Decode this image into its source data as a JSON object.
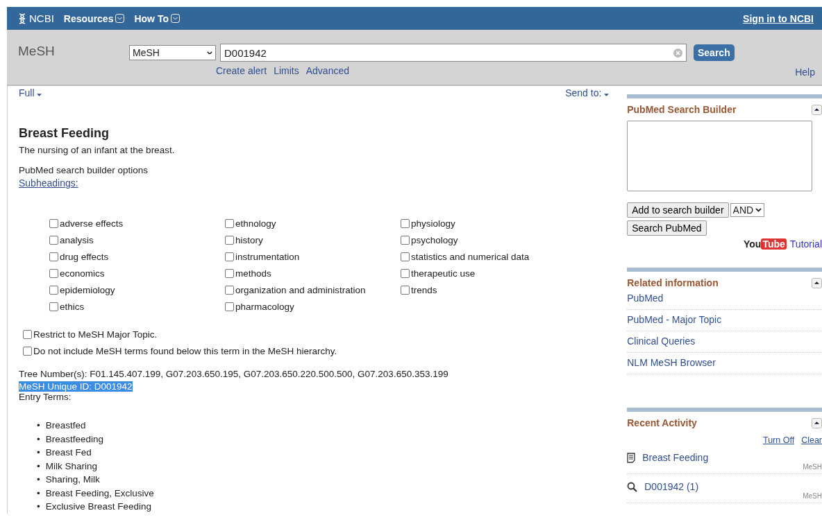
{
  "topbar": {
    "logo": "NCBI",
    "menus": [
      {
        "label": "Resources"
      },
      {
        "label": "How To"
      }
    ],
    "sign_in": "Sign in to NCBI"
  },
  "search": {
    "database_label": "MeSH",
    "database": "MeSH",
    "value": "D001942",
    "button": "Search",
    "links": [
      "Create alert",
      "Limits",
      "Advanced"
    ],
    "help": "Help"
  },
  "content": {
    "display": "Full",
    "send_to": "Send to:",
    "title": "Breast Feeding",
    "definition": "The nursing of an infant at the breast.",
    "builder_options": "PubMed search builder options",
    "subheadings_link": "Subheadings:",
    "subheadings": [
      [
        {
          "label": "adverse effects",
          "checked": false
        },
        {
          "label": "analysis",
          "checked": false
        },
        {
          "label": "drug effects",
          "checked": false
        },
        {
          "label": "economics",
          "checked": false
        },
        {
          "label": "epidemiology",
          "checked": false
        },
        {
          "label": "ethics",
          "checked": false
        }
      ],
      [
        {
          "label": "ethnology",
          "checked": false
        },
        {
          "label": "history",
          "checked": false
        },
        {
          "label": "instrumentation",
          "checked": false
        },
        {
          "label": "methods",
          "checked": false
        },
        {
          "label": "organization and administration",
          "checked": false
        },
        {
          "label": "pharmacology",
          "checked": false
        }
      ],
      [
        {
          "label": "physiology",
          "checked": false
        },
        {
          "label": "psychology",
          "checked": false
        },
        {
          "label": "statistics and numerical data",
          "checked": false
        },
        {
          "label": "therapeutic use",
          "checked": false
        },
        {
          "label": "trends",
          "checked": false
        }
      ]
    ],
    "options": [
      {
        "label": "Restrict to MeSH Major Topic.",
        "checked": false
      },
      {
        "label": "Do not include MeSH terms found below this term in the MeSH hierarchy.",
        "checked": false
      }
    ],
    "tree_numbers": "Tree Number(s): F01.145.407.199, G07.203.650.195, G07.203.650.220.500.500, G07.203.650.353.199",
    "unique_id": {
      "text": "MeSH Unique ID: D001942",
      "highlighted": true
    },
    "entry_terms_label": "Entry Terms:",
    "entry_marker": "•",
    "entry_terms": [
      "Breastfed",
      "Breastfeeding",
      "Breast Fed",
      "Milk Sharing",
      "Sharing, Milk",
      "Breast Feeding, Exclusive",
      "Exclusive Breast Feeding"
    ]
  },
  "sidebar": {
    "builder": {
      "title": "PubMed Search Builder",
      "add_button": "Add to search builder",
      "operator": "AND",
      "search_button": "Search PubMed",
      "youtube": [
        "You",
        "Tube"
      ],
      "tutorial": "Tutorial"
    },
    "related": {
      "title": "Related information",
      "links": [
        "PubMed",
        "PubMed - Major Topic",
        "Clinical Queries",
        "NLM MeSH Browser"
      ]
    },
    "recent": {
      "title": "Recent Activity",
      "actions": [
        "Turn Off",
        "Clear"
      ],
      "items": [
        {
          "kind": "record",
          "label": "Breast Feeding",
          "db": "MeSH"
        },
        {
          "kind": "search",
          "label": "D001942 (1)",
          "db": "MeSH"
        }
      ]
    }
  }
}
